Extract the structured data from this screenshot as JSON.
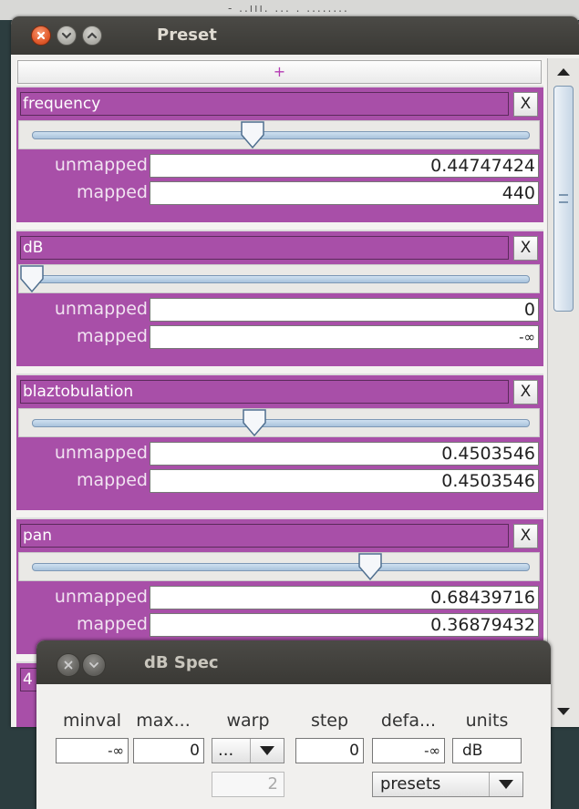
{
  "main_window": {
    "title": "Preset",
    "add_label": "+",
    "panels": [
      {
        "name": "frequency",
        "close": "X",
        "slider_fraction": 0.447,
        "unmapped_label": "unmapped",
        "unmapped_value": "0.44747424",
        "mapped_label": "mapped",
        "mapped_value": "440"
      },
      {
        "name": "dB",
        "close": "X",
        "slider_fraction": 0.0,
        "unmapped_label": "unmapped",
        "unmapped_value": "0",
        "mapped_label": "mapped",
        "mapped_value": "-∞"
      },
      {
        "name": "blaztobulation",
        "close": "X",
        "slider_fraction": 0.45,
        "unmapped_label": "unmapped",
        "unmapped_value": "0.4503546",
        "mapped_label": "mapped",
        "mapped_value": "0.4503546"
      },
      {
        "name": "pan",
        "close": "X",
        "slider_fraction": 0.684,
        "unmapped_label": "unmapped",
        "unmapped_value": "0.68439716",
        "mapped_label": "mapped",
        "mapped_value": "0.36879432"
      }
    ],
    "next_panel_label": "4"
  },
  "spec_window": {
    "title": "dB Spec",
    "columns": {
      "minval": "minval",
      "maxval": "max...",
      "warp": "warp",
      "step": "step",
      "default": "defa...",
      "units": "units"
    },
    "values": {
      "minval": "-∞",
      "maxval": "0",
      "warp": "...",
      "step": "0",
      "default": "-∞",
      "units": "dB",
      "curve": "2"
    },
    "presets_label": "presets"
  }
}
